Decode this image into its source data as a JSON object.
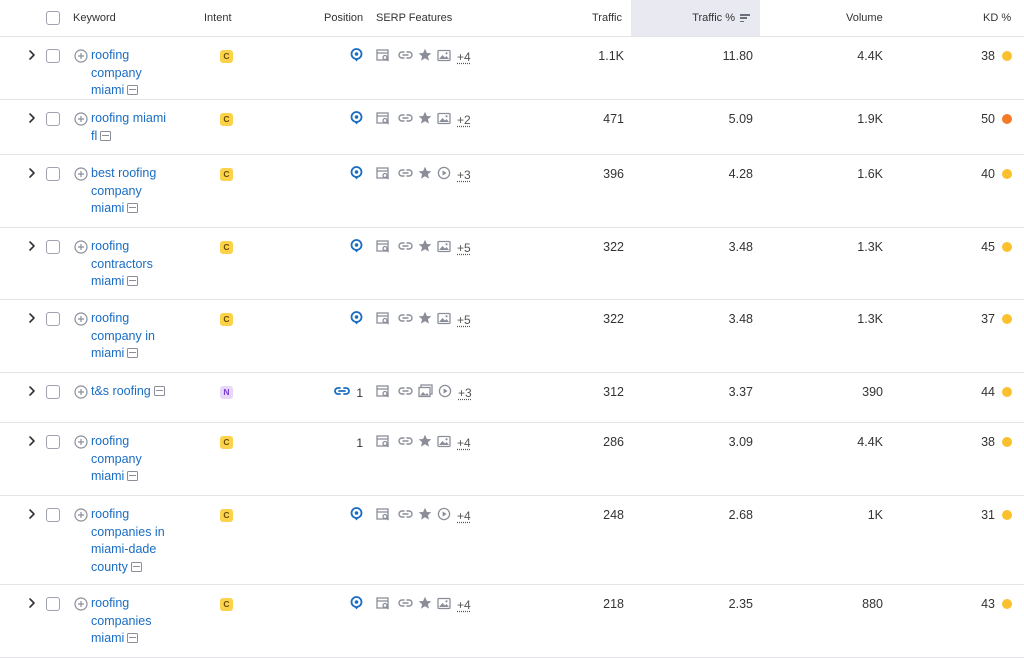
{
  "header": {
    "keyword": "Keyword",
    "intent": "Intent",
    "position": "Position",
    "serp_features": "SERP Features",
    "traffic": "Traffic",
    "traffic_pct": "Traffic %",
    "volume": "Volume",
    "kd": "KD %"
  },
  "colors": {
    "link": "#1a6dc4",
    "intent_commercial": "#fcd24a",
    "intent_navigational": "#e8d6fb",
    "kd_medium": "#fbc02d",
    "kd_hard": "#f37b26"
  },
  "rows": [
    {
      "kw_lines": [
        "roofing",
        "company",
        "miami"
      ],
      "intent": "C",
      "position": "",
      "position_icon": "location-pin-icon",
      "features": [
        "serp-snippet-icon",
        "link-icon",
        "star-icon",
        "image-icon"
      ],
      "more": "+4",
      "traffic": "1.1K",
      "traffic_pct": "11.80",
      "volume": "4.4K",
      "kd": "38",
      "kd_color": "#fbc02d"
    },
    {
      "kw_lines": [
        "roofing miami",
        "fl"
      ],
      "intent": "C",
      "position": "",
      "position_icon": "location-pin-icon",
      "features": [
        "serp-snippet-icon",
        "link-icon",
        "star-icon",
        "image-icon"
      ],
      "more": "+2",
      "traffic": "471",
      "traffic_pct": "5.09",
      "volume": "1.9K",
      "kd": "50",
      "kd_color": "#f37b26"
    },
    {
      "kw_lines": [
        "best roofing",
        "company",
        "miami"
      ],
      "intent": "C",
      "position": "",
      "position_icon": "location-pin-icon",
      "features": [
        "serp-snippet-icon",
        "link-icon",
        "star-icon",
        "video-icon"
      ],
      "more": "+3",
      "traffic": "396",
      "traffic_pct": "4.28",
      "volume": "1.6K",
      "kd": "40",
      "kd_color": "#fbc02d"
    },
    {
      "kw_lines": [
        "roofing",
        "contractors",
        "miami"
      ],
      "intent": "C",
      "position": "",
      "position_icon": "location-pin-icon",
      "features": [
        "serp-snippet-icon",
        "link-icon",
        "star-icon",
        "image-icon"
      ],
      "more": "+5",
      "traffic": "322",
      "traffic_pct": "3.48",
      "volume": "1.3K",
      "kd": "45",
      "kd_color": "#fbc02d"
    },
    {
      "kw_lines": [
        "roofing",
        "company in",
        "miami"
      ],
      "intent": "C",
      "position": "",
      "position_icon": "location-pin-icon",
      "features": [
        "serp-snippet-icon",
        "link-icon",
        "star-icon",
        "image-icon"
      ],
      "more": "+5",
      "traffic": "322",
      "traffic_pct": "3.48",
      "volume": "1.3K",
      "kd": "37",
      "kd_color": "#fbc02d"
    },
    {
      "kw_lines": [
        "t&s roofing"
      ],
      "intent": "N",
      "position": "1",
      "position_icon": "sitelinks-icon",
      "features": [
        "serp-snippet-icon",
        "link-icon",
        "gallery-icon",
        "video-icon"
      ],
      "more": "+3",
      "traffic": "312",
      "traffic_pct": "3.37",
      "volume": "390",
      "kd": "44",
      "kd_color": "#fbc02d"
    },
    {
      "kw_lines": [
        "roofing",
        "company",
        "miami"
      ],
      "intent": "C",
      "position": "1",
      "position_icon": "",
      "features": [
        "serp-snippet-icon",
        "link-icon",
        "star-icon",
        "image-icon"
      ],
      "more": "+4",
      "traffic": "286",
      "traffic_pct": "3.09",
      "volume": "4.4K",
      "kd": "38",
      "kd_color": "#fbc02d"
    },
    {
      "kw_lines": [
        "roofing",
        "companies in",
        "miami-dade",
        "county"
      ],
      "intent": "C",
      "position": "",
      "position_icon": "location-pin-icon",
      "features": [
        "serp-snippet-icon",
        "link-icon",
        "star-icon",
        "video-icon"
      ],
      "more": "+4",
      "traffic": "248",
      "traffic_pct": "2.68",
      "volume": "1K",
      "kd": "31",
      "kd_color": "#fbc02d"
    },
    {
      "kw_lines": [
        "roofing",
        "companies",
        "miami"
      ],
      "intent": "C",
      "position": "",
      "position_icon": "location-pin-icon",
      "features": [
        "serp-snippet-icon",
        "link-icon",
        "star-icon",
        "image-icon"
      ],
      "more": "+4",
      "traffic": "218",
      "traffic_pct": "2.35",
      "volume": "880",
      "kd": "43",
      "kd_color": "#fbc02d"
    }
  ]
}
